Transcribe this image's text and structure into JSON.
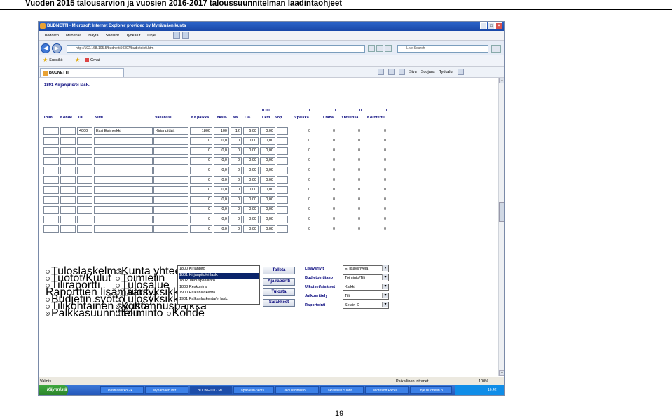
{
  "doc_title": "Vuoden 2015 talousarvion ja vuosien 2016-2017 taloussuunnitelman laadintaohjeet",
  "page_number": "19",
  "browser": {
    "window_title": "BUDNETTI - Microsoft Internet Explorer provided by Mynämäen kunta",
    "menu": [
      "Tiedosto",
      "Muokkaa",
      "Näytä",
      "Suosikit",
      "Työkalut",
      "Ohje"
    ],
    "address": "http://192.168.105.5/budnetti50307/budjetointi.htm",
    "search_placeholder": "Live Search",
    "favorites_label": "Suosikit",
    "fav_links": [
      "Gmail"
    ],
    "tab_label": "BUDNETTI",
    "tools": [
      "Sivu",
      "Suojaus",
      "Työkalut"
    ]
  },
  "app": {
    "section_title": "1801 Kirjanpito/ei lask.",
    "totals": {
      "lkm": "0.00",
      "vpalkka": "0",
      "lraha": "0",
      "yhteensa": "0",
      "korotettu": "0"
    },
    "columns": [
      "Toim.",
      "Kohde",
      "Tili",
      "Nimi",
      "Vakanssi",
      "KKpalkka",
      "Yks%",
      "KK",
      "L%",
      "Lkm",
      "Sop.",
      "Vpalkka",
      "Lraha",
      "Yhteensä",
      "Korotettu"
    ],
    "first_row": {
      "tili": "4000",
      "nimi": "Essi Esimerkki",
      "vakanssi": "Kirjanpitäjä",
      "kkpalkka": "1800",
      "yks": "100",
      "kk": "12",
      "lpros": "6,00",
      "lkm": "0,00"
    },
    "empty_row": {
      "kkpalkka": "0",
      "yks": "0,0",
      "kk": "0",
      "lpros": "0,00",
      "lkm": "0,00"
    },
    "row_values": [
      "0",
      "0",
      "0",
      "0"
    ],
    "radio_col1": [
      {
        "label": "Tuloslaskelma",
        "checked": false
      },
      {
        "label": "Tuotot/Kulut",
        "checked": false
      },
      {
        "label": "Tiliraportti",
        "checked": false
      },
      {
        "label": "Raporttien lisämäärit.",
        "checked": false,
        "checkbox": true
      },
      {
        "label": "Budjetin syöttö",
        "checked": false
      },
      {
        "label": "Tilikohtainen syöttö",
        "checked": false
      },
      {
        "label": "Palkkasuunnittelu",
        "checked": true
      }
    ],
    "radio_col2": [
      {
        "label": "Kunta yhteensä",
        "checked": false
      },
      {
        "label": "Toimielin",
        "checked": false
      },
      {
        "label": "Tulosalue",
        "checked": false
      },
      {
        "label": "Tulosyksikkö1",
        "checked": false
      },
      {
        "label": "Tulosyksikkö2",
        "checked": false
      },
      {
        "label": "Kustannuspaikka",
        "checked": true
      },
      {
        "label": "Toiminto",
        "checked": false,
        "extra": "Kohde"
      }
    ],
    "list_items": [
      "1800 Kirjanpito",
      "1801 Kirjanpito/ei lask.",
      "1802 Talouspäällikkö",
      "1803 Reskontra",
      "1900 Palkanlaskenta",
      "1901 Palkanlaskenta/ei lask."
    ],
    "list_selected": 1,
    "buttons": [
      "Talleta",
      "Aja raportti",
      "Tulosta",
      "Sarakkeet"
    ],
    "right_labels": [
      "Lisäysrivit",
      "Budjetointitaso",
      "Ulkoiset/sisäiset",
      "Jatkoerittely",
      "Raportointi"
    ],
    "right_values": [
      "Ei lisäysrivejä",
      "Toiminto/Tili",
      "Kaikki",
      "Tili",
      "Selain €"
    ]
  },
  "status": {
    "left": "Valmis",
    "zone": "Paikallinen intranet",
    "zoom": "100%"
  },
  "taskbar": {
    "start": "Käynnistä",
    "tasks": [
      "Postilaatikko - k...",
      "Mynämäen Intr...",
      "BUDNETTI - Mi...",
      "\\\\palvelin2\\koti\\...",
      "Taloustoimisto",
      "\\\\Palvelin2\\Joht...",
      "Microsoft Excel ...",
      "Ohje Budnetin p..."
    ],
    "clock": "16:42"
  }
}
